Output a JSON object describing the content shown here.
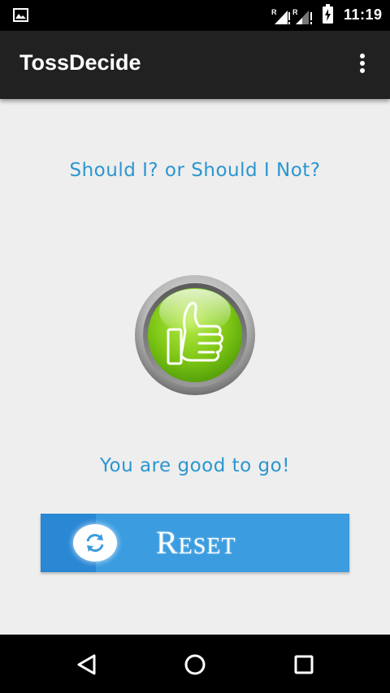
{
  "status_bar": {
    "time": "11:19",
    "icons": [
      "image-notification-icon",
      "signal-roaming-icon",
      "signal-roaming-icon-2",
      "battery-charging-icon"
    ]
  },
  "app_bar": {
    "title": "TossDecide",
    "menu_icon": "overflow-menu-icon"
  },
  "main": {
    "question": "Should I? or Should I Not?",
    "result_icon": "thumbs-up-icon",
    "result_text": "You are good to go!",
    "reset_label": "Reset",
    "reset_icon": "refresh-icon"
  },
  "nav_bar": {
    "buttons": [
      "back-icon",
      "home-icon",
      "recents-icon"
    ]
  },
  "colors": {
    "accent_text": "#2a96d0",
    "reset_button": "#3b9ce0",
    "thumb_green": "#7cc514",
    "app_bar": "#212121",
    "background": "#eeeeee"
  }
}
